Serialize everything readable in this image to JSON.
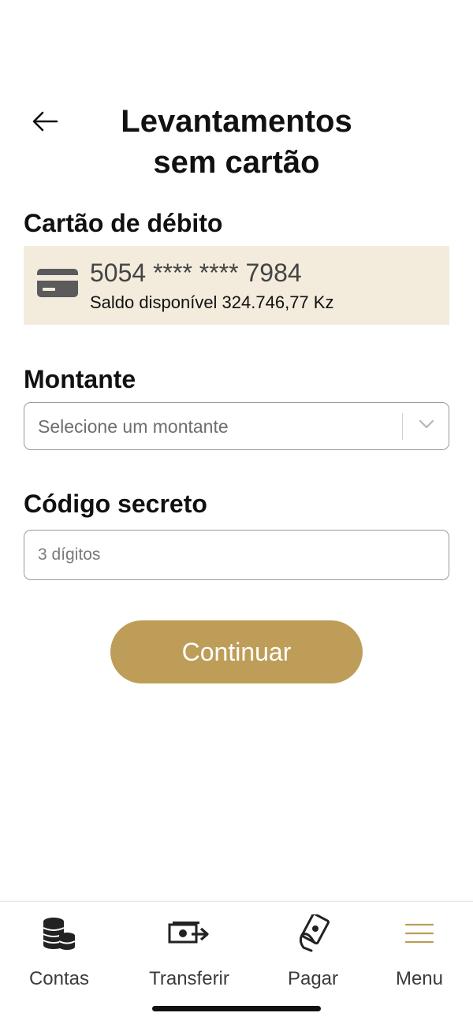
{
  "header": {
    "title_line1": "Levantamentos",
    "title_line2": "sem cartão",
    "back_icon": "arrow-left-icon"
  },
  "card_section": {
    "label": "Cartão de débito",
    "card_icon": "credit-card-icon",
    "card_number": "5054 **** **** 7984",
    "balance_text": "Saldo disponível 324.746,77 Kz",
    "background_color": "#f3ecdd"
  },
  "amount_section": {
    "label": "Montante",
    "select_placeholder": "Selecione um montante",
    "chevron_icon": "chevron-down-icon"
  },
  "code_section": {
    "label": "Código secreto",
    "input_placeholder": "3 dígitos"
  },
  "continue_button": {
    "label": "Continuar",
    "color": "#bd9d57"
  },
  "tabbar": {
    "items": [
      {
        "label": "Contas",
        "icon": "coins-stack-icon"
      },
      {
        "label": "Transferir",
        "icon": "money-transfer-icon"
      },
      {
        "label": "Pagar",
        "icon": "hand-payment-icon"
      },
      {
        "label": "Menu",
        "icon": "hamburger-menu-icon",
        "accent_color": "#bd9d57"
      }
    ]
  }
}
